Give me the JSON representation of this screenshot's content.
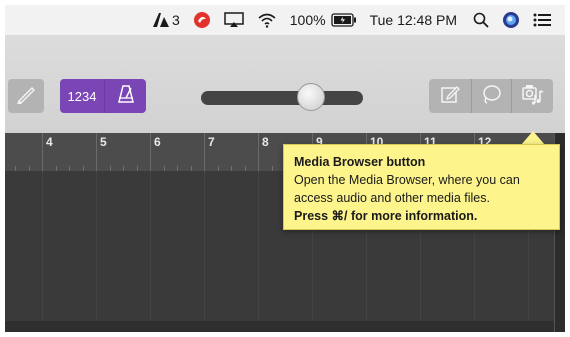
{
  "menubar": {
    "extra_status_text": "3",
    "battery_percent": "100%",
    "clock": "Tue 12:48 PM",
    "icons": [
      "adobe-status-icon",
      "red-app-status-icon",
      "airplay-icon",
      "wifi-icon",
      "battery-icon",
      "spotlight-icon",
      "siri-icon",
      "notification-center-icon"
    ]
  },
  "toolbar": {
    "count_in_label": "1234",
    "accent_color": "#7a45b5",
    "master_volume_fraction": 0.68,
    "icons": [
      "pencil-icon",
      "metronome-icon",
      "notepad-icon",
      "loops-icon",
      "media-browser-icon"
    ]
  },
  "ruler": {
    "bars": [
      "4",
      "5",
      "6",
      "7",
      "8",
      "9",
      "10",
      "11",
      "12"
    ]
  },
  "tooltip": {
    "title": "Media Browser button",
    "body": "Open the Media Browser, where you can access audio and other media files.",
    "help": "Press ⌘/ for more information."
  }
}
